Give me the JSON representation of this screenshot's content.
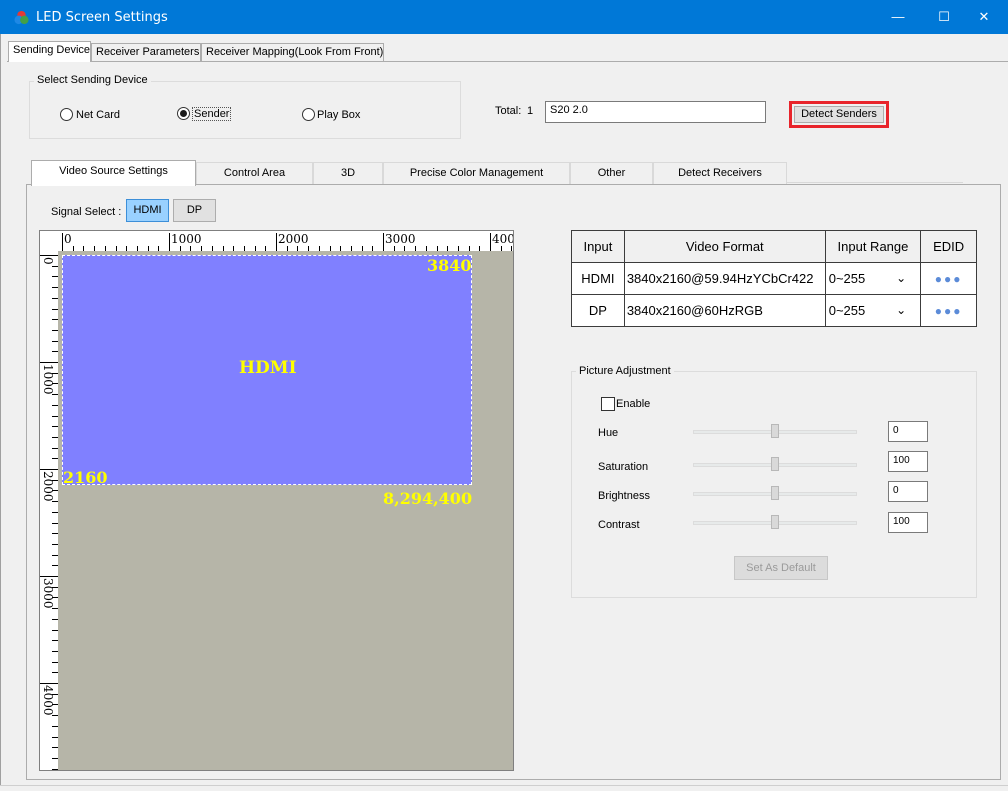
{
  "window": {
    "title": "LED Screen Settings",
    "minimize_glyph": "—",
    "maximize_glyph": "☐",
    "close_glyph": "✕",
    "title_bar_color": "#0078d7"
  },
  "top_tabs": [
    {
      "label": "Sending Device",
      "active": true
    },
    {
      "label": "Receiver Parameters",
      "active": false
    },
    {
      "label": "Receiver Mapping(Look From Front)",
      "active": false
    }
  ],
  "sending_device": {
    "group_title": "Select Sending Device",
    "options": [
      {
        "label": "Net Card",
        "checked": false
      },
      {
        "label": "Sender",
        "checked": true
      },
      {
        "label": "Play Box",
        "checked": false
      }
    ],
    "total_label": "Total:",
    "total_value": "1",
    "device_field_value": "S20 2.0",
    "detect_button": "Detect Senders",
    "highlight_color": "#e8242b"
  },
  "inner_tabs": [
    {
      "label": "Video Source Settings",
      "active": true
    },
    {
      "label": "Control Area",
      "active": false
    },
    {
      "label": "3D",
      "active": false
    },
    {
      "label": "Precise Color Management",
      "active": false
    },
    {
      "label": "Other",
      "active": false
    },
    {
      "label": "Detect Receivers",
      "active": false
    }
  ],
  "signal_select": {
    "label": "Signal Select :",
    "options": [
      {
        "label": "HDMI",
        "selected": true
      },
      {
        "label": "DP",
        "selected": false
      }
    ]
  },
  "canvas": {
    "source_label": "HDMI",
    "width_label": "3840",
    "height_label": "2160",
    "pixels_label": "8,294,400",
    "h_ruler_labels": [
      "0",
      "1000",
      "2000",
      "3000",
      "400"
    ],
    "v_ruler_labels": [
      "0",
      "1000",
      "2000",
      "3000",
      "4000"
    ]
  },
  "format_table": {
    "headers": [
      "Input",
      "Video Format",
      "Input Range",
      "EDID"
    ],
    "rows": [
      {
        "input": "HDMI",
        "format": "3840x2160@59.94HzYCbCr422",
        "range": "0~255",
        "edid": "●●●"
      },
      {
        "input": "DP",
        "format": "3840x2160@60HzRGB",
        "range": "0~255",
        "edid": "●●●"
      }
    ],
    "dropdown_glyph": "⌄"
  },
  "picture_adjustment": {
    "title": "Picture Adjustment",
    "enable_label": "Enable",
    "enabled": false,
    "sliders": [
      {
        "label": "Hue",
        "value": "0"
      },
      {
        "label": "Saturation",
        "value": "100"
      },
      {
        "label": "Brightness",
        "value": "0"
      },
      {
        "label": "Contrast",
        "value": "100"
      }
    ],
    "default_button": "Set As Default"
  }
}
